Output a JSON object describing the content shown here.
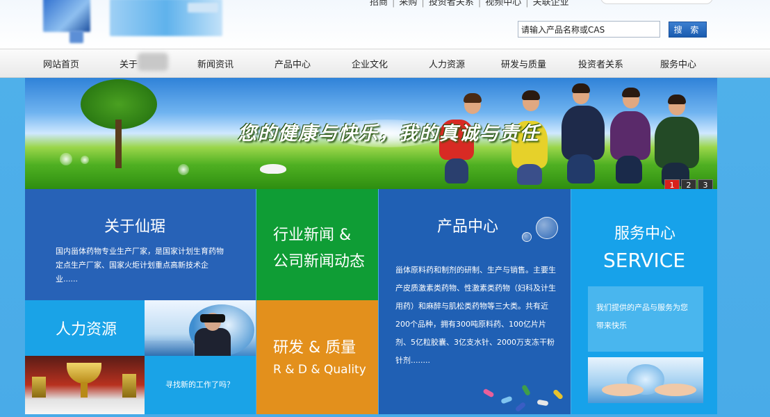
{
  "header": {
    "top_links": [
      "招商",
      "采购",
      "投资者关系",
      "视频中心",
      "关联企业"
    ],
    "search_placeholder": "请输入产品名称或CAS",
    "search_button": "搜 索"
  },
  "nav": {
    "items": [
      "网站首页",
      "关于",
      "新闻资讯",
      "产品中心",
      "企业文化",
      "人力资源",
      "研发与质量",
      "投资者关系",
      "服务中心"
    ]
  },
  "banner": {
    "slogan": "您的健康与快乐，我的真诚与责任",
    "slides": [
      "1",
      "2",
      "3"
    ],
    "active_slide": 1
  },
  "tiles": {
    "about": {
      "title": "关于仙琚",
      "body": "国内甾体药物专业生产厂家，是国家计划生育药物定点生产厂家、国家火炬计划重点高新技术企业......"
    },
    "news": {
      "title_line1": "行业新闻 &",
      "title_line2": "公司新闻动态"
    },
    "products": {
      "title": "产品中心",
      "body": "甾体原料药和制剂的研制、生产与销售。主要生产皮质激素类药物、性激素类药物（妇科及计生用药）和麻醉与肌松类药物等三大类。共有近200个品种，拥有300吨原料药、100亿片片剂、5亿粒胶囊、3亿支水针、2000万支冻干粉针剂........"
    },
    "service": {
      "title": "服务中心",
      "subtitle": "SERVICE",
      "body": "我们提供的产品与服务为您带来快乐"
    },
    "hr": {
      "title": "人力资源"
    },
    "jobs": {
      "text": "寻找新的工作了吗？"
    },
    "rd": {
      "title": "研发 & 质量",
      "subtitle": "R & D & Quality"
    }
  },
  "colors": {
    "about": "#2762b7",
    "news": "#0f9d35",
    "products": "#2060b4",
    "service": "#17a2ea",
    "hr": "#1aa3e7",
    "rd": "#e3901c",
    "active_dot": "#d8201c"
  }
}
